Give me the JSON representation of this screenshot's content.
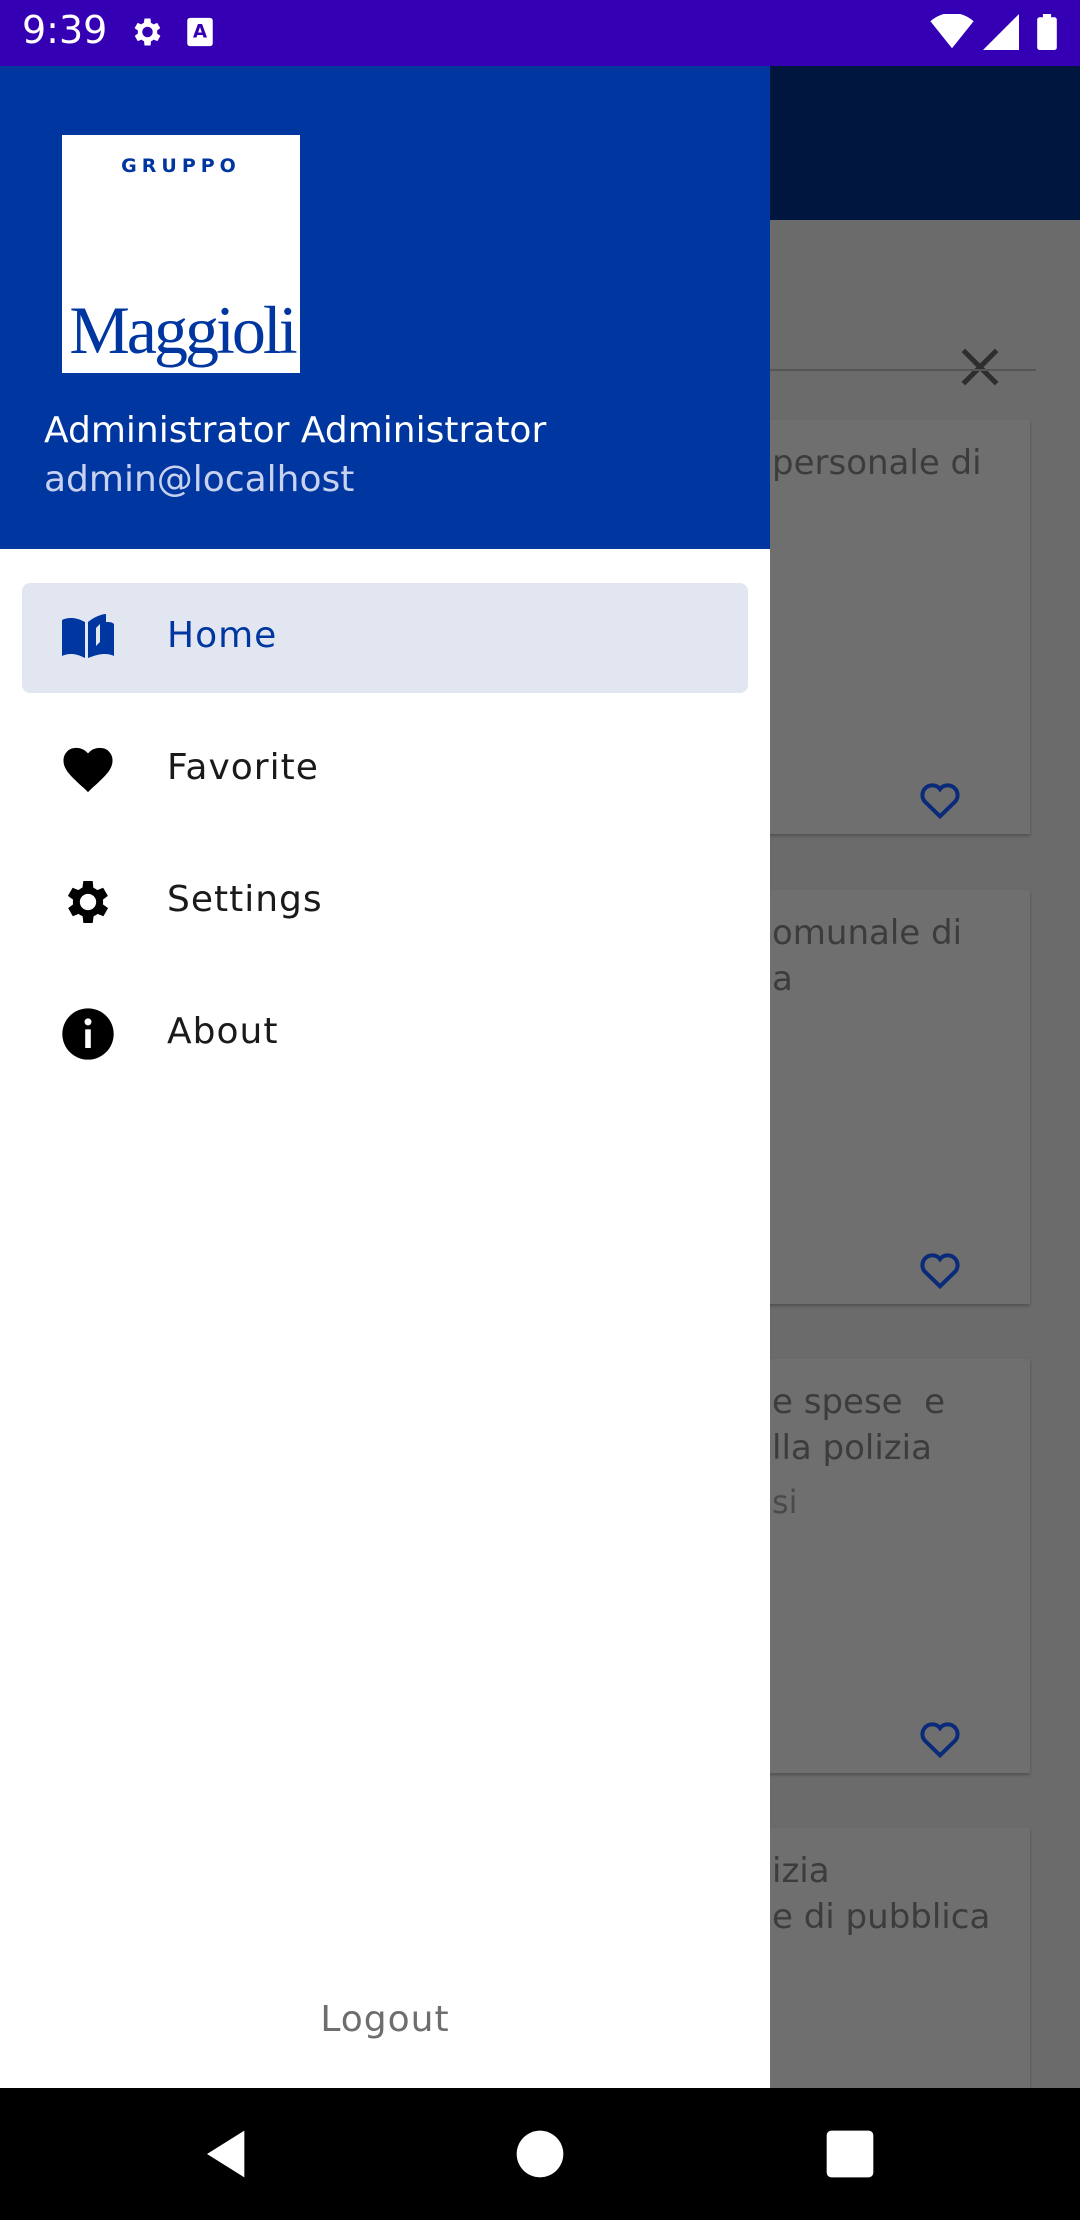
{
  "status_bar": {
    "time": "9:39",
    "icons_left": [
      "gear-icon",
      "text-a-icon"
    ],
    "icons_right": [
      "wifi-icon",
      "signal-icon",
      "battery-icon"
    ],
    "color": "#3500b3"
  },
  "drawer": {
    "logo": {
      "top": "GRUPPO",
      "name": "Maggioli"
    },
    "user_name": "Administrator Administrator",
    "user_email": "admin@localhost",
    "header_color": "#0036a0",
    "items": [
      {
        "label": "Home",
        "icon": "book-icon",
        "active": true
      },
      {
        "label": "Favorite",
        "icon": "heart-icon",
        "active": false
      },
      {
        "label": "Settings",
        "icon": "gear-icon",
        "active": false
      },
      {
        "label": "About",
        "icon": "info-icon",
        "active": false
      }
    ],
    "logout_label": "Logout"
  },
  "background": {
    "cards": [
      {
        "title": "personale di",
        "sub": ""
      },
      {
        "title": "omunale di\na",
        "sub": ""
      },
      {
        "title": "e spese  e\nlla polizia",
        "sub": "si"
      },
      {
        "title": "izia\ne di pubblica",
        "sub": ""
      }
    ]
  },
  "nav_bar": {
    "buttons": [
      "back-icon",
      "home-circle-icon",
      "recents-square-icon"
    ]
  }
}
